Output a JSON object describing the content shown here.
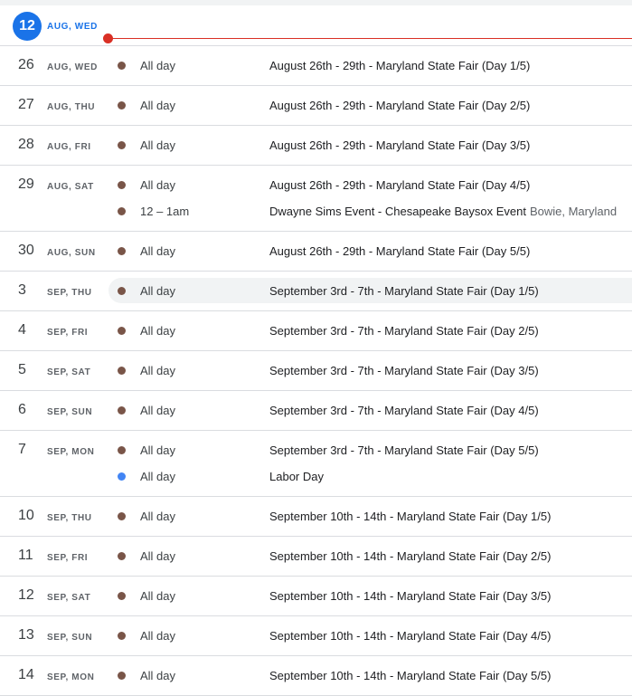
{
  "today": {
    "number": "12",
    "label": "AUG, WED"
  },
  "colors": {
    "accent": "#1a73e8",
    "event_brown": "#795548",
    "event_blue": "#4285f4",
    "now_line": "#d93025"
  },
  "days": [
    {
      "num": "26",
      "label": "AUG, WED",
      "events": [
        {
          "time": "All day",
          "title": "August 26th - 29th - Maryland State Fair (Day 1/5)",
          "color": "#795548"
        }
      ]
    },
    {
      "num": "27",
      "label": "AUG, THU",
      "events": [
        {
          "time": "All day",
          "title": "August 26th - 29th - Maryland State Fair (Day 2/5)",
          "color": "#795548"
        }
      ]
    },
    {
      "num": "28",
      "label": "AUG, FRI",
      "events": [
        {
          "time": "All day",
          "title": "August 26th - 29th - Maryland State Fair (Day 3/5)",
          "color": "#795548"
        }
      ]
    },
    {
      "num": "29",
      "label": "AUG, SAT",
      "events": [
        {
          "time": "All day",
          "title": "August 26th - 29th - Maryland State Fair (Day 4/5)",
          "color": "#795548"
        },
        {
          "time": "12 – 1am",
          "title": "Dwayne Sims Event - Chesapeake Baysox Event",
          "location": "Bowie, Maryland",
          "color": "#795548"
        }
      ]
    },
    {
      "num": "30",
      "label": "AUG, SUN",
      "events": [
        {
          "time": "All day",
          "title": "August 26th - 29th - Maryland State Fair (Day 5/5)",
          "color": "#795548"
        }
      ]
    },
    {
      "num": "3",
      "label": "SEP, THU",
      "events": [
        {
          "time": "All day",
          "title": "September 3rd - 7th - Maryland State Fair (Day 1/5)",
          "color": "#795548",
          "hover": true
        }
      ]
    },
    {
      "num": "4",
      "label": "SEP, FRI",
      "events": [
        {
          "time": "All day",
          "title": "September 3rd - 7th - Maryland State Fair (Day 2/5)",
          "color": "#795548"
        }
      ]
    },
    {
      "num": "5",
      "label": "SEP, SAT",
      "events": [
        {
          "time": "All day",
          "title": "September 3rd - 7th - Maryland State Fair (Day 3/5)",
          "color": "#795548"
        }
      ]
    },
    {
      "num": "6",
      "label": "SEP, SUN",
      "events": [
        {
          "time": "All day",
          "title": "September 3rd - 7th - Maryland State Fair (Day 4/5)",
          "color": "#795548"
        }
      ]
    },
    {
      "num": "7",
      "label": "SEP, MON",
      "events": [
        {
          "time": "All day",
          "title": "September 3rd - 7th - Maryland State Fair (Day 5/5)",
          "color": "#795548"
        },
        {
          "time": "All day",
          "title": "Labor Day",
          "color": "#4285f4"
        }
      ]
    },
    {
      "num": "10",
      "label": "SEP, THU",
      "events": [
        {
          "time": "All day",
          "title": "September 10th - 14th - Maryland State Fair (Day 1/5)",
          "color": "#795548"
        }
      ]
    },
    {
      "num": "11",
      "label": "SEP, FRI",
      "events": [
        {
          "time": "All day",
          "title": "September 10th - 14th - Maryland State Fair (Day 2/5)",
          "color": "#795548"
        }
      ]
    },
    {
      "num": "12",
      "label": "SEP, SAT",
      "events": [
        {
          "time": "All day",
          "title": "September 10th - 14th - Maryland State Fair (Day 3/5)",
          "color": "#795548"
        }
      ]
    },
    {
      "num": "13",
      "label": "SEP, SUN",
      "events": [
        {
          "time": "All day",
          "title": "September 10th - 14th - Maryland State Fair (Day 4/5)",
          "color": "#795548"
        }
      ]
    },
    {
      "num": "14",
      "label": "SEP, MON",
      "events": [
        {
          "time": "All day",
          "title": "September 10th - 14th - Maryland State Fair (Day 5/5)",
          "color": "#795548"
        }
      ]
    }
  ]
}
